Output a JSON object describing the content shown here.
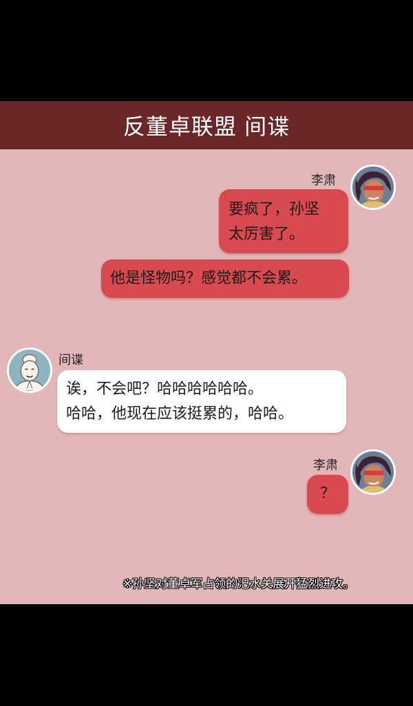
{
  "header": {
    "title": "反董卓联盟 间谍"
  },
  "messages": [
    {
      "sender": "李肃",
      "lines": [
        "要疯了，孙坚",
        "太厉害了。"
      ]
    },
    {
      "sender": "李肃",
      "lines": [
        "他是怪物吗？感觉都不会累。"
      ]
    },
    {
      "sender": "间谍",
      "lines": [
        "诶，不会吧？哈哈哈哈哈哈。",
        "哈哈，他现在应该挺累的，哈哈。"
      ]
    },
    {
      "sender": "李肃",
      "lines": [
        "？"
      ]
    }
  ],
  "avatars": {
    "lisu": "lisu-avatar",
    "spy": "spy-avatar"
  },
  "footnote": "※孙坚对董卓军占领的汜水关展开猛烈进攻。",
  "colors": {
    "background": "#000000",
    "panel": "#e3b6b9",
    "header": "#6b2627",
    "red_bubble": "#d84a4f",
    "white_bubble": "#ffffff"
  }
}
